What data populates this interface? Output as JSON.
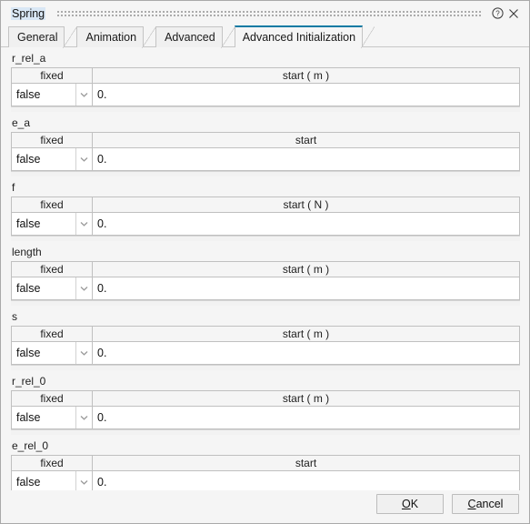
{
  "window": {
    "title": "Spring",
    "help_icon": "help-circle-icon",
    "close_icon": "close-icon"
  },
  "tabs": [
    {
      "label": "General",
      "active": false
    },
    {
      "label": "Animation",
      "active": false
    },
    {
      "label": "Advanced",
      "active": false
    },
    {
      "label": "Advanced Initialization",
      "active": true
    }
  ],
  "accent_color": "#0a7aa3",
  "columns": {
    "fixed": "fixed"
  },
  "groups": [
    {
      "name": "r_rel_a",
      "fixed_header": "fixed",
      "start_header": "start ( m )",
      "fixed_value": "false",
      "start_value": "0."
    },
    {
      "name": "e_a",
      "fixed_header": "fixed",
      "start_header": "start",
      "fixed_value": "false",
      "start_value": "0."
    },
    {
      "name": "f",
      "fixed_header": "fixed",
      "start_header": "start ( N )",
      "fixed_value": "false",
      "start_value": "0."
    },
    {
      "name": "length",
      "fixed_header": "fixed",
      "start_header": "start ( m )",
      "fixed_value": "false",
      "start_value": "0."
    },
    {
      "name": "s",
      "fixed_header": "fixed",
      "start_header": "start ( m )",
      "fixed_value": "false",
      "start_value": "0."
    },
    {
      "name": "r_rel_0",
      "fixed_header": "fixed",
      "start_header": "start ( m )",
      "fixed_value": "false",
      "start_value": "0."
    },
    {
      "name": "e_rel_0",
      "fixed_header": "fixed",
      "start_header": "start",
      "fixed_value": "false",
      "start_value": "0."
    }
  ],
  "footer": {
    "ok": {
      "mnemonic": "O",
      "rest": "K"
    },
    "cancel": {
      "mnemonic": "C",
      "rest": "ancel"
    }
  }
}
